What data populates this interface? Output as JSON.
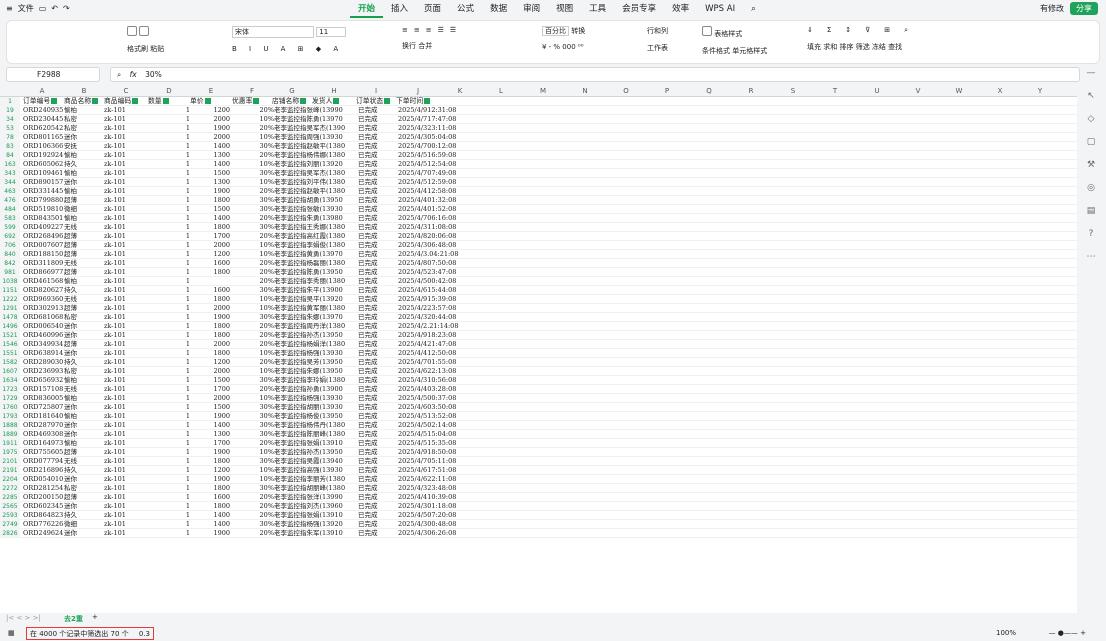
{
  "topbar": {
    "file_menu": "文件",
    "tabs": [
      "开始",
      "插入",
      "页面",
      "公式",
      "数据",
      "审阅",
      "视图",
      "工具",
      "会员专享",
      "效率",
      "WPS AI"
    ],
    "right_edit": "有修改",
    "right_share": "分享"
  },
  "ribbon": {
    "format_painter": "格式刷",
    "paste": "粘贴",
    "font_name": "宋体",
    "font_size": "11",
    "wrap": "换行",
    "merge": "合并",
    "number_format": "百分比",
    "convert": "转换",
    "rows_cols": "行和列",
    "worksheet": "工作表",
    "conditional_format": "条件格式",
    "table_style": "表格样式",
    "cell_style": "单元格样式",
    "fill": "填充",
    "sum": "求和",
    "sort": "排序",
    "filter": "筛选",
    "freeze": "冻结",
    "find": "查找"
  },
  "formula_bar": {
    "name_box": "F2988",
    "fx": "fx",
    "value": "30%"
  },
  "columns": [
    "A",
    "B",
    "C",
    "D",
    "E",
    "F",
    "G",
    "H",
    "I",
    "J",
    "K",
    "L",
    "M",
    "N",
    "O",
    "P",
    "Q",
    "R",
    "S",
    "T",
    "U",
    "V",
    "W",
    "X",
    "Y"
  ],
  "header_row": {
    "num": "1",
    "cells": [
      "订单编号",
      "商品名称",
      "商品编码",
      "数量",
      "单价",
      "优惠率",
      "店铺名称",
      "发货人",
      "订单状态",
      "下单时间"
    ]
  },
  "rows": [
    {
      "n": "19",
      "a": "ORD240935",
      "b": "愉柏",
      "c": "zk-101",
      "d": "1",
      "e": "1200",
      "f": "20%",
      "g": "老李监控指张峰(13990",
      "h": "已完成",
      "j": "2025/4/912:31:08"
    },
    {
      "n": "34",
      "a": "ORD230445",
      "b": "私密",
      "c": "zk-101",
      "d": "1",
      "e": "2000",
      "f": "10%",
      "g": "老李监控指陈勇(13970",
      "h": "已完成",
      "j": "2025/4/717:47:08"
    },
    {
      "n": "53",
      "a": "ORD620542",
      "b": "私密",
      "c": "zk-101",
      "d": "1",
      "e": "1900",
      "f": "20%",
      "g": "老李监控指吴军杰(1390",
      "h": "已完成",
      "j": "2025/4/323:11:08"
    },
    {
      "n": "78",
      "a": "ORD801165",
      "b": "迷你",
      "c": "zk-101",
      "d": "1",
      "e": "2000",
      "f": "10%",
      "g": "老李监控指周强(13930",
      "h": "已完成",
      "j": "2025/4/305:04:08"
    },
    {
      "n": "83",
      "a": "ORD106366",
      "b": "安抚",
      "c": "zk-101",
      "d": "1",
      "e": "1400",
      "f": "30%",
      "g": "老李监控指赵敏平(1380",
      "h": "已完成",
      "j": "2025/4/700:12:08"
    },
    {
      "n": "84",
      "a": "ORD192924",
      "b": "愉柏",
      "c": "zk-101",
      "d": "1",
      "e": "1300",
      "f": "20%",
      "g": "老李监控指杨伟娜(1380",
      "h": "已完成",
      "j": "2025/4/516:59:08"
    },
    {
      "n": "163",
      "a": "ORD605062",
      "b": "持久",
      "c": "zk-101",
      "d": "1",
      "e": "1400",
      "f": "10%",
      "g": "老李监控指刘丽(13920",
      "h": "已完成",
      "j": "2025/4/512:54:08"
    },
    {
      "n": "343",
      "a": "ORD109461",
      "b": "愉柏",
      "c": "zk-101",
      "d": "1",
      "e": "1500",
      "f": "30%",
      "g": "老李监控指吴军杰(1380",
      "h": "已完成",
      "j": "2025/4/707:49:08"
    },
    {
      "n": "344",
      "a": "ORD890157",
      "b": "迷你",
      "c": "zk-101",
      "d": "1",
      "e": "1300",
      "f": "10%",
      "g": "老李监控指刘平伟(1380",
      "h": "已完成",
      "j": "2025/4/512:59:08"
    },
    {
      "n": "463",
      "a": "ORD331445",
      "b": "愉柏",
      "c": "zk-101",
      "d": "1",
      "e": "1900",
      "f": "20%",
      "g": "老李监控指赵敏平(1380",
      "h": "已完成",
      "j": "2025/4/412:58:08"
    },
    {
      "n": "476",
      "a": "ORD799880",
      "b": "超薄",
      "c": "zk-101",
      "d": "1",
      "e": "1800",
      "f": "30%",
      "g": "老李监控指胡勇(13950",
      "h": "已完成",
      "j": "2025/4/401:32:08"
    },
    {
      "n": "484",
      "a": "ORD519810",
      "b": "微细",
      "c": "zk-101",
      "d": "1",
      "e": "1500",
      "f": "30%",
      "g": "老李监控指张敏(13930",
      "h": "已完成",
      "j": "2025/4/401:52:08"
    },
    {
      "n": "583",
      "a": "ORD843501",
      "b": "愉柏",
      "c": "zk-101",
      "d": "1",
      "e": "1400",
      "f": "20%",
      "g": "老李监控指朱勇(13980",
      "h": "已完成",
      "j": "2025/4/706:16:08"
    },
    {
      "n": "599",
      "a": "ORD409227",
      "b": "无线",
      "c": "zk-101",
      "d": "1",
      "e": "1800",
      "f": "30%",
      "g": "老李监控指王秀娜(1380",
      "h": "已完成",
      "j": "2025/4/311:08:08"
    },
    {
      "n": "692",
      "a": "ORD268496",
      "b": "超薄",
      "c": "zk-101",
      "d": "1",
      "e": "1700",
      "f": "20%",
      "g": "老李监控指高红霞(1380",
      "h": "已完成",
      "j": "2025/4/820:06:08"
    },
    {
      "n": "706",
      "a": "ORD007607",
      "b": "超薄",
      "c": "zk-101",
      "d": "1",
      "e": "2000",
      "f": "10%",
      "g": "老李监控指李娟俊(1380",
      "h": "已完成",
      "j": "2025/4/306:48:08"
    },
    {
      "n": "840",
      "a": "ORD188150",
      "b": "超薄",
      "c": "zk-101",
      "d": "1",
      "e": "1200",
      "f": "10%",
      "g": "老李监控指黄勇(13970",
      "h": "已完成",
      "j": "2025/4/3.04:21:08"
    },
    {
      "n": "842",
      "a": "ORD311809",
      "b": "无线",
      "c": "zk-101",
      "d": "1",
      "e": "1600",
      "f": "20%",
      "g": "老李监控指杨磊丽(1380",
      "h": "已完成",
      "j": "2025/4/807:50:08"
    },
    {
      "n": "981",
      "a": "ORD866977",
      "b": "超薄",
      "c": "zk-101",
      "d": "1",
      "e": "1800",
      "f": "20%",
      "g": "老李监控指陈勇(13950",
      "h": "已完成",
      "j": "2025/4/523:47:08"
    },
    {
      "n": "1038",
      "a": "ORD461568",
      "b": "愉柏",
      "c": "zk-101",
      "d": "1",
      "e": "",
      "f": "20%",
      "g": "老李监控指李秀丽(1380",
      "h": "已完成",
      "j": "2025/4/500:42:08"
    },
    {
      "n": "1151",
      "a": "ORD820627",
      "b": "持久",
      "c": "zk-101",
      "d": "1",
      "e": "1600",
      "f": "30%",
      "g": "老李监控指朱平(13900",
      "h": "已完成",
      "j": "2025/4/615:44:08"
    },
    {
      "n": "1222",
      "a": "ORD969360",
      "b": "无线",
      "c": "zk-101",
      "d": "1",
      "e": "1800",
      "f": "10%",
      "g": "老李监控指吴平(13920",
      "h": "已完成",
      "j": "2025/4/915:39:08"
    },
    {
      "n": "1291",
      "a": "ORD302913",
      "b": "超薄",
      "c": "zk-101",
      "d": "1",
      "e": "2000",
      "f": "10%",
      "g": "老李监控指黄军丽(1380",
      "h": "已完成",
      "j": "2025/4/223:57:08"
    },
    {
      "n": "1478",
      "a": "ORD681068",
      "b": "私密",
      "c": "zk-101",
      "d": "1",
      "e": "1900",
      "f": "30%",
      "g": "老李监控指朱娜(13970",
      "h": "已完成",
      "j": "2025/4/320:44:08"
    },
    {
      "n": "1496",
      "a": "ORD006540",
      "b": "迷你",
      "c": "zk-101",
      "d": "1",
      "e": "1800",
      "f": "20%",
      "g": "老李监控指周丹洋(1380",
      "h": "已完成",
      "j": "2025/4/2.21:14:08"
    },
    {
      "n": "1521",
      "a": "ORD460996",
      "b": "迷你",
      "c": "zk-101",
      "d": "1",
      "e": "1800",
      "f": "20%",
      "g": "老李监控指孙杰(13950",
      "h": "已完成",
      "j": "2025/4/918:23:08"
    },
    {
      "n": "1546",
      "a": "ORD349934",
      "b": "超薄",
      "c": "zk-101",
      "d": "1",
      "e": "2000",
      "f": "20%",
      "g": "老李监控指杨娟洋(1380",
      "h": "已完成",
      "j": "2025/4/421:47:08"
    },
    {
      "n": "1551",
      "a": "ORD638914",
      "b": "迷你",
      "c": "zk-101",
      "d": "1",
      "e": "1800",
      "f": "10%",
      "g": "老李监控指杨强(13930",
      "h": "已完成",
      "j": "2025/4/412:50:08"
    },
    {
      "n": "1582",
      "a": "ORD289030",
      "b": "持久",
      "c": "zk-101",
      "d": "1",
      "e": "1200",
      "f": "20%",
      "g": "老李监控指吴芳(13950",
      "h": "已完成",
      "j": "2025/4/701:55:08"
    },
    {
      "n": "1607",
      "a": "ORD236993",
      "b": "私密",
      "c": "zk-101",
      "d": "1",
      "e": "2000",
      "f": "10%",
      "g": "老李监控指朱娜(13950",
      "h": "已完成",
      "j": "2025/4/622:13:08"
    },
    {
      "n": "1634",
      "a": "ORD656932",
      "b": "愉柏",
      "c": "zk-101",
      "d": "1",
      "e": "1500",
      "f": "30%",
      "g": "老李监控指李玲娟(1380",
      "h": "已完成",
      "j": "2025/4/310:56:08"
    },
    {
      "n": "1723",
      "a": "ORD157108",
      "b": "无线",
      "c": "zk-101",
      "d": "1",
      "e": "1700",
      "f": "20%",
      "g": "老李监控指孙勇(13900",
      "h": "已完成",
      "j": "2025/4/403:28:08"
    },
    {
      "n": "1729",
      "a": "ORD836005",
      "b": "愉柏",
      "c": "zk-101",
      "d": "1",
      "e": "2000",
      "f": "10%",
      "g": "老李监控指杨强(13930",
      "h": "已完成",
      "j": "2025/4/500:37:08"
    },
    {
      "n": "1760",
      "a": "ORD725807",
      "b": "迷你",
      "c": "zk-101",
      "d": "1",
      "e": "1500",
      "f": "30%",
      "g": "老李监控指胡丽(13930",
      "h": "已完成",
      "j": "2025/4/603:50:08"
    },
    {
      "n": "1793",
      "a": "ORD181640",
      "b": "愉柏",
      "c": "zk-101",
      "d": "1",
      "e": "1900",
      "f": "30%",
      "g": "老李监控指杨俊(13950",
      "h": "已完成",
      "j": "2025/4/513:52:08"
    },
    {
      "n": "1888",
      "a": "ORD287970",
      "b": "迷你",
      "c": "zk-101",
      "d": "1",
      "e": "1400",
      "f": "30%",
      "g": "老李监控指杨伟丹(1380",
      "h": "已完成",
      "j": "2025/4/502:14:08"
    },
    {
      "n": "1889",
      "a": "ORD469308",
      "b": "迷你",
      "c": "zk-101",
      "d": "1",
      "e": "1300",
      "f": "30%",
      "g": "老李监控指陈丽峰(1380",
      "h": "已完成",
      "j": "2025/4/515:04:08"
    },
    {
      "n": "1911",
      "a": "ORD164973",
      "b": "愉柏",
      "c": "zk-101",
      "d": "1",
      "e": "1700",
      "f": "20%",
      "g": "老李监控指张娟(13910",
      "h": "已完成",
      "j": "2025/4/515:35:08"
    },
    {
      "n": "1975",
      "a": "ORD755605",
      "b": "超薄",
      "c": "zk-101",
      "d": "1",
      "e": "1900",
      "f": "10%",
      "g": "老李监控指孙杰(13950",
      "h": "已完成",
      "j": "2025/4/918:50:08"
    },
    {
      "n": "2101",
      "a": "ORD077794",
      "b": "无线",
      "c": "zk-101",
      "d": "1",
      "e": "1800",
      "f": "30%",
      "g": "老李监控指吴霞(13940",
      "h": "已完成",
      "j": "2025/4/705:11:08"
    },
    {
      "n": "2191",
      "a": "ORD216896",
      "b": "持久",
      "c": "zk-101",
      "d": "1",
      "e": "1200",
      "f": "10%",
      "g": "老李监控指高强(13930",
      "h": "已完成",
      "j": "2025/4/617:51:08"
    },
    {
      "n": "2204",
      "a": "ORD054010",
      "b": "迷你",
      "c": "zk-101",
      "d": "1",
      "e": "1900",
      "f": "10%",
      "g": "老李监控指李丽芳(1380",
      "h": "已完成",
      "j": "2025/4/622:11:08"
    },
    {
      "n": "2272",
      "a": "ORD281254",
      "b": "私密",
      "c": "zk-101",
      "d": "1",
      "e": "1800",
      "f": "30%",
      "g": "老李监控指胡丽峰(1380",
      "h": "已完成",
      "j": "2025/4/323:48:08"
    },
    {
      "n": "2285",
      "a": "ORD200150",
      "b": "超薄",
      "c": "zk-101",
      "d": "1",
      "e": "1600",
      "f": "20%",
      "g": "老李监控指张洋(13990",
      "h": "已完成",
      "j": "2025/4/410:39:08"
    },
    {
      "n": "2565",
      "a": "ORD602345",
      "b": "迷你",
      "c": "zk-101",
      "d": "1",
      "e": "1800",
      "f": "20%",
      "g": "老李监控指刘杰(13960",
      "h": "已完成",
      "j": "2025/4/301:18:08"
    },
    {
      "n": "2593",
      "a": "ORD864823",
      "b": "持久",
      "c": "zk-101",
      "d": "1",
      "e": "1400",
      "f": "20%",
      "g": "老李监控指张娟(13910",
      "h": "已完成",
      "j": "2025/4/507:20:08"
    },
    {
      "n": "2749",
      "a": "ORD776226",
      "b": "微细",
      "c": "zk-101",
      "d": "1",
      "e": "1400",
      "f": "30%",
      "g": "老李监控指杨强(13920",
      "h": "已完成",
      "j": "2025/4/300:48:08"
    },
    {
      "n": "2826",
      "a": "ORD249624",
      "b": "迷你",
      "c": "zk-101",
      "d": "1",
      "e": "1900",
      "f": "20%",
      "g": "老李监控指朱军(13910",
      "h": "已完成",
      "j": "2025/4/306:26:08"
    }
  ],
  "sheet_tabs": {
    "active": "去2重",
    "add": "+"
  },
  "status": {
    "filter_text": "在 4000 个记录中筛选出 70 个",
    "avg": "0.3",
    "zoom": "100%"
  }
}
